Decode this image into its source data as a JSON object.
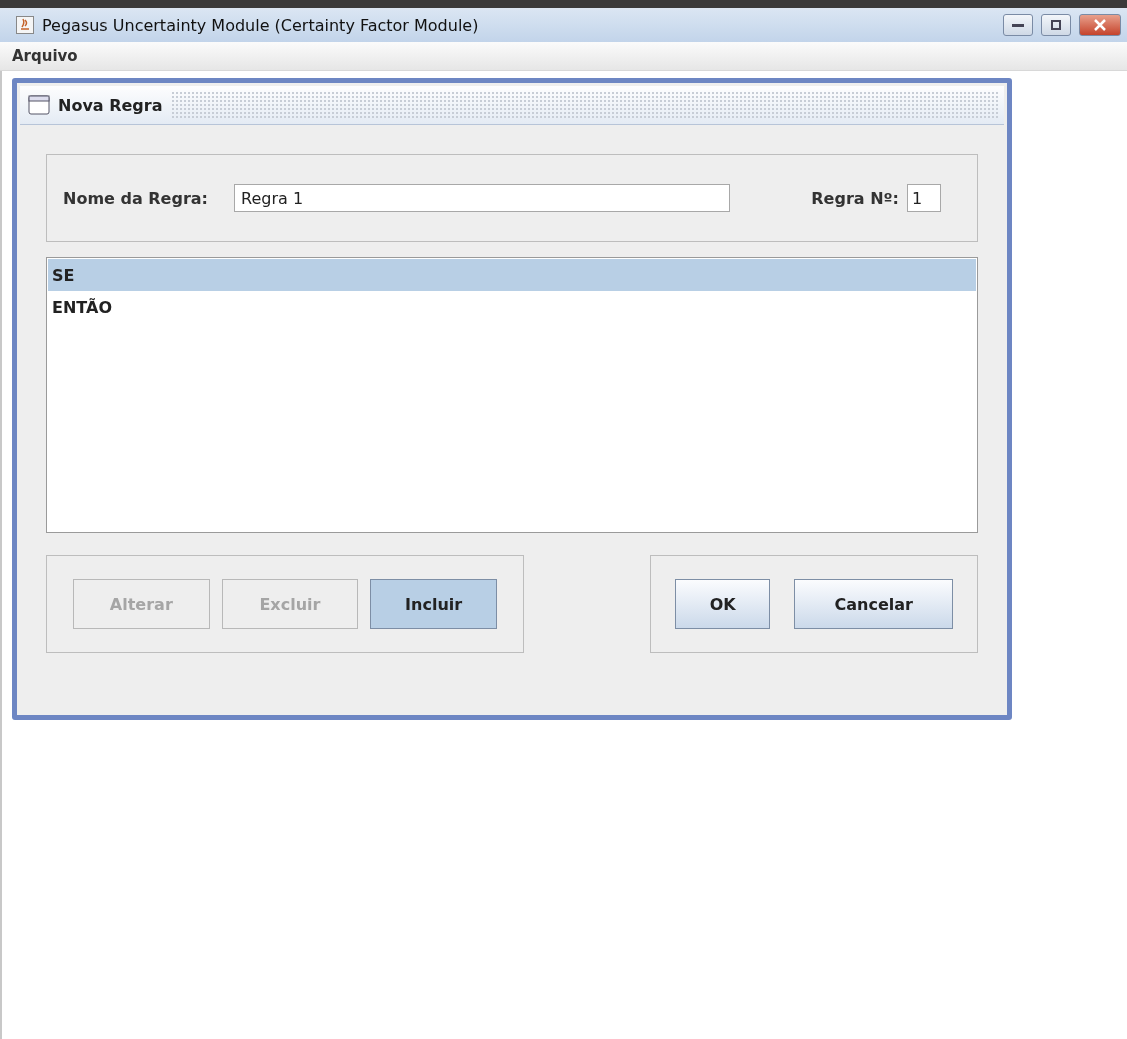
{
  "window": {
    "title": "Pegasus Uncertainty Module (Certainty Factor Module)"
  },
  "menu": [
    {
      "label": "Arquivo"
    }
  ],
  "dialog": {
    "title": "Nova Regra",
    "name_label": "Nome da Regra:",
    "name_value": "Regra 1",
    "number_label": "Regra Nº:",
    "number_value": "1",
    "rules": [
      {
        "label": "SE",
        "selected": true
      },
      {
        "label": "ENTÃO",
        "selected": false
      }
    ],
    "edit_buttons": [
      {
        "label": "Alterar",
        "disabled": true,
        "focused": false
      },
      {
        "label": "Excluir",
        "disabled": true,
        "focused": false
      },
      {
        "label": "Incluir",
        "disabled": false,
        "focused": true
      }
    ],
    "action_buttons": [
      {
        "label": "OK",
        "disabled": false,
        "focused": false
      },
      {
        "label": "Cancelar",
        "disabled": false,
        "focused": false
      }
    ]
  }
}
